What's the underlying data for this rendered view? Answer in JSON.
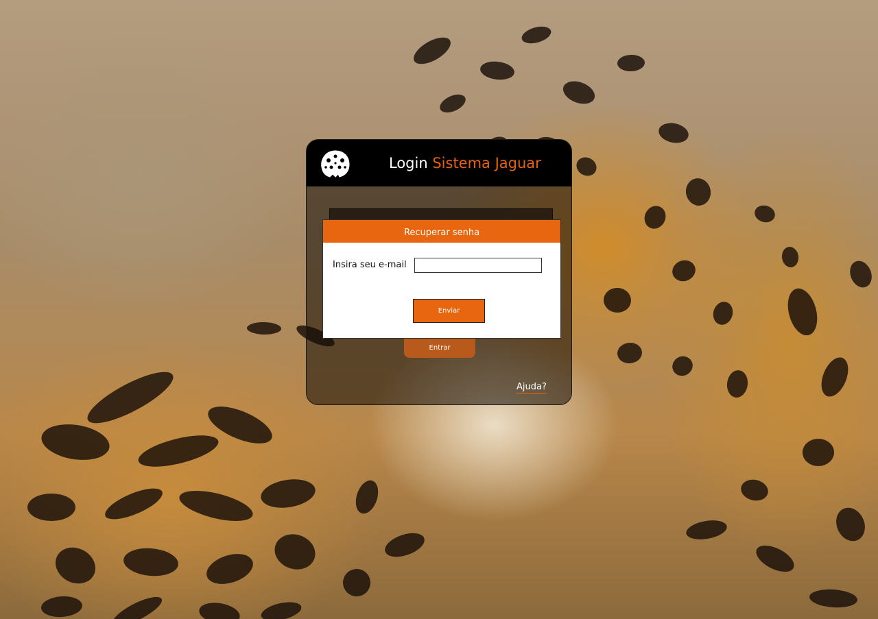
{
  "login": {
    "title_prefix": "Login",
    "title_accent": "Sistema Jaguar",
    "enter_label": "Entrar",
    "help_label": "Ajuda?"
  },
  "recover_modal": {
    "title": "Recuperar senha",
    "email_label": "Insira seu e-mail",
    "email_value": "",
    "send_label": "Enviar"
  },
  "colors": {
    "accent": "#e8660f",
    "header_bg": "#000000"
  },
  "icons": {
    "logo": "jaguar-logo-icon"
  }
}
